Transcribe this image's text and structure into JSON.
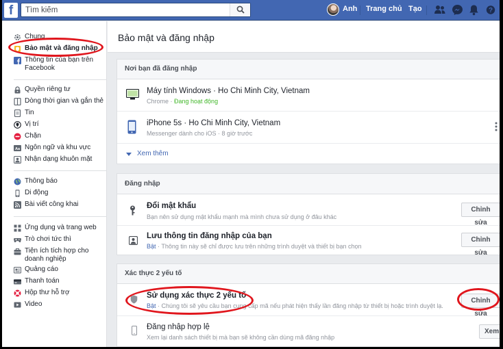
{
  "topbar": {
    "logo": "f",
    "search_placeholder": "Tìm kiếm",
    "user_name": "Anh",
    "home_label": "Trang chủ",
    "create_label": "Tạo"
  },
  "sidebar": {
    "items": [
      {
        "label": "Chung",
        "icon": "gear-icon"
      },
      {
        "label": "Bảo mật và đăng nhập",
        "icon": "shield-icon"
      },
      {
        "label": "Thông tin của bạn trên Facebook",
        "icon": "facebook-icon"
      },
      {
        "label": "Quyền riêng tư",
        "icon": "lock-icon"
      },
      {
        "label": "Dòng thời gian và gắn thẻ",
        "icon": "timeline-icon"
      },
      {
        "label": "Tin",
        "icon": "story-icon"
      },
      {
        "label": "Vị trí",
        "icon": "location-icon"
      },
      {
        "label": "Chặn",
        "icon": "block-icon"
      },
      {
        "label": "Ngôn ngữ và khu vực",
        "icon": "language-icon"
      },
      {
        "label": "Nhận dạng khuôn mặt",
        "icon": "face-icon"
      },
      {
        "label": "Thông báo",
        "icon": "globe-icon"
      },
      {
        "label": "Di động",
        "icon": "mobile-icon"
      },
      {
        "label": "Bài viết công khai",
        "icon": "rss-icon"
      },
      {
        "label": "Ứng dụng và trang web",
        "icon": "apps-icon"
      },
      {
        "label": "Trò chơi tức thì",
        "icon": "game-icon"
      },
      {
        "label": "Tiện ích tích hợp cho doanh nghiệp",
        "icon": "business-icon"
      },
      {
        "label": "Quảng cáo",
        "icon": "ads-icon"
      },
      {
        "label": "Thanh toán",
        "icon": "payment-icon"
      },
      {
        "label": "Hộp thư hỗ trợ",
        "icon": "support-icon"
      },
      {
        "label": "Video",
        "icon": "video-icon"
      }
    ]
  },
  "main": {
    "title": "Bảo mật và đăng nhập",
    "where_logged_in": {
      "header": "Nơi bạn đã đăng nhập",
      "sessions": [
        {
          "device": "Máy tính Windows · Ho Chi Minh City, Vietnam",
          "app": "Chrome",
          "sep": " · ",
          "status": "Đang hoạt động"
        },
        {
          "device": "iPhone 5s · Ho Chi Minh City, Vietnam",
          "detail": "Messenger dành cho iOS · 8 giờ trước"
        }
      ],
      "see_more": "Xem thêm"
    },
    "login": {
      "header": "Đăng nhập",
      "items": [
        {
          "title": "Đổi mật khẩu",
          "sub": "Bạn nên sử dụng mật khẩu mạnh mà mình chưa sử dụng ở đâu khác",
          "button": "Chỉnh sửa"
        },
        {
          "title": "Lưu thông tin đăng nhập của bạn",
          "sub_on": "Bật",
          "sub": " · Thông tin này sẽ chỉ được lưu trên những trình duyệt và thiết bị bạn chọn",
          "button": "Chỉnh sửa"
        }
      ]
    },
    "two_factor": {
      "header": "Xác thực 2 yếu tố",
      "items": [
        {
          "title": "Sử dụng xác thực 2 yếu tố",
          "sub_on": "Bật",
          "sub": " · Chúng tôi sẽ yêu cầu bạn cung cấp mã nếu phát hiện thấy lần đăng nhập từ thiết bị hoặc trình duyệt lạ.",
          "button": "Chỉnh sửa"
        },
        {
          "title": "Đăng nhập hợp lệ",
          "sub": "Xem lại danh sách thiết bị mà bạn sẽ không cần dùng mã đăng nhập",
          "button": "Xem"
        }
      ]
    }
  },
  "colors": {
    "brand": "#4267b2",
    "active_green": "#42b72a",
    "annotation_red": "#e0161d"
  }
}
